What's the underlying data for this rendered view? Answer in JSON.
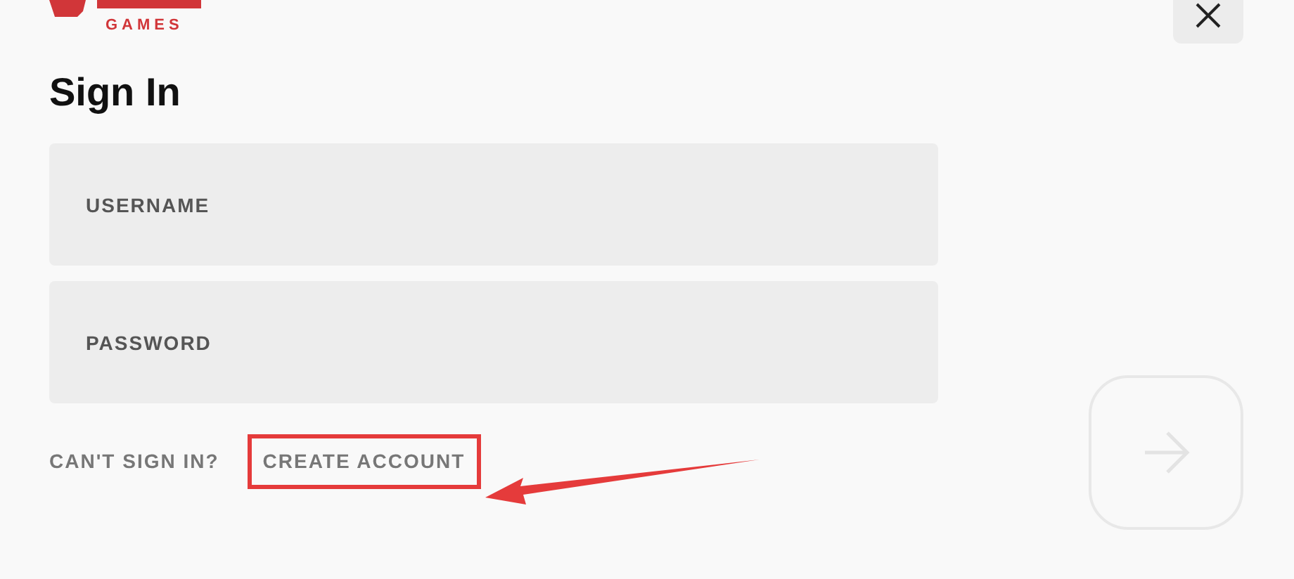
{
  "logo": {
    "subtitle": "GAMES"
  },
  "title": "Sign In",
  "fields": [
    {
      "placeholder": "USERNAME"
    },
    {
      "placeholder": "PASSWORD"
    }
  ],
  "links": [
    {
      "label": "CAN'T SIGN IN?",
      "highlighted": false
    },
    {
      "label": "CREATE ACCOUNT",
      "highlighted": true
    }
  ],
  "submit": {
    "disabled": true
  }
}
